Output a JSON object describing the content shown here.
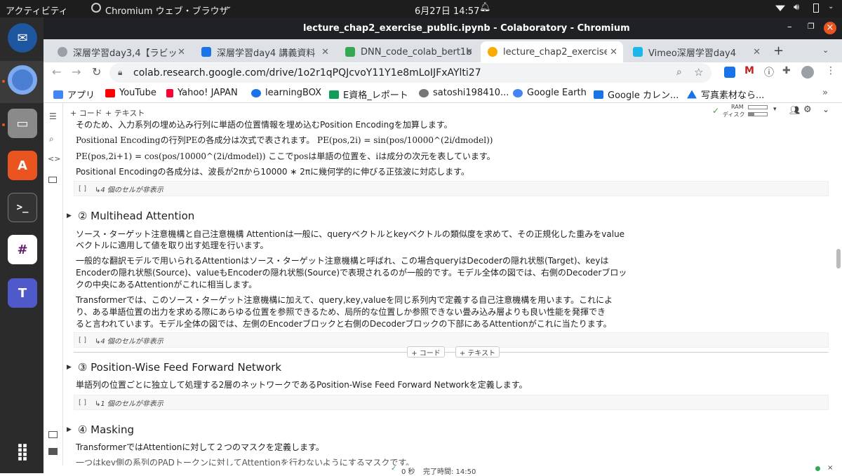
{
  "ubuntu": {
    "activities": "アクティビティ",
    "app_menu": "Chromium ウェブ・ブラウザ",
    "clock": "6月27日  14:57"
  },
  "window": {
    "title": "lecture_chap2_exercise_public.ipynb - Colaboratory - Chromium"
  },
  "tabs": [
    {
      "label": "深層学習day3,4【ラビッ",
      "color": "#9aa0a6"
    },
    {
      "label": "深層学習day4 講義資料",
      "color": "#1a73e8"
    },
    {
      "label": "DNN_code_colab_bert1b",
      "color": "#34a853"
    },
    {
      "label": "lecture_chap2_exercise_",
      "color": "#f9ab00"
    },
    {
      "label": "Vimeo深層学習day4",
      "color": "#1ab7ea"
    }
  ],
  "address": {
    "url": "colab.research.google.com/drive/1o2r1qPQJcvoY11Y1e8mLoIJFxAYlti27"
  },
  "bookmarks": [
    {
      "label": "アプリ",
      "color": "#4285f4"
    },
    {
      "label": "YouTube",
      "color": "#ff0000"
    },
    {
      "label": "Yahoo! JAPAN",
      "color": "#ff0033"
    },
    {
      "label": "learningBOX",
      "color": "#1a73e8"
    },
    {
      "label": "E資格_レポート",
      "color": "#0f9d58"
    },
    {
      "label": "satoshi198410...",
      "color": "#777777"
    },
    {
      "label": "Google Earth",
      "color": "#4285f4"
    },
    {
      "label": "Google カレン...",
      "color": "#1a73e8"
    },
    {
      "label": "写真素材なら...",
      "color": "#1a73e8"
    }
  ],
  "colab_toolbar": {
    "code_button": "+ コード",
    "text_button": "+ テキスト",
    "ram": "RAM",
    "disk": "ディスク"
  },
  "cells": {
    "pe_line1": "そのため、入力系列の埋め込み行列に単語の位置情報を埋め込むPosition Encodingを加算します。",
    "pe_line2": "Positional Encodingの行列PEの各成分は次式で表されます。 PE(pos,2i) = sin(pos/10000^(2i/dmodel))",
    "pe_line3": "PE(pos,2i+1) = cos(pos/10000^(2i/dmodel)) ここでposは単語の位置を、iは成分の次元を表しています。",
    "pe_line4": "Positional Encodingの各成分は、波長が2πから10000 ∗ 2πに幾何学的に伸びる正弦波に対応します。",
    "hidden1": "↳4 個のセルが非表示",
    "h2": "② Multihead Attention",
    "mh_p1_l1": "ソース・ターゲット注意機構と自己注意機構 Attentionは一般に、queryベクトルとkeyベクトルの類似度を求めて、その正規化した重みをvalue",
    "mh_p1_l2": "ベクトルに適用して値を取り出す処理を行います。",
    "mh_p2_l1": "一般的な翻訳モデルで用いられるAttentionはソース・ターゲット注意機構と呼ばれ、この場合queryはDecoderの隠れ状態(Target)、keyは",
    "mh_p2_l2": "Encoderの隠れ状態(Source)、valueもEncoderの隠れ状態(Source)で表現されるのが一般的です。モデル全体の図では、右側のDecoderブロッ",
    "mh_p2_l3": "クの中央にあるAttentionがこれに相当します。",
    "mh_p3_l1": "Transformerでは、このソース・ターゲット注意機構に加えて、query,key,valueを同じ系列内で定義する自己注意機構を用います。これによ",
    "mh_p3_l2": "り、ある単語位置の出力を求める際にあらゆる位置を参照できるため、局所的な位置しか参照できない畳み込み層よりも良い性能を発揮でき",
    "mh_p3_l3": "ると言われています。モデル全体の図では、左側のEncoderブロックと右側のDecoderブロックの下部にあるAttentionがこれに当たります。",
    "hidden2": "↳4 個のセルが非表示",
    "add_code": "+ コード",
    "add_text": "+ テキスト",
    "h3": "③ Position-Wise Feed Forward Network",
    "ff_p": "単語列の位置ごとに独立して処理する2層のネットワークであるPosition-Wise Feed Forward Networkを定義します。",
    "hidden3": "↳1 個のセルが非表示",
    "h4": "④ Masking",
    "mask_p": "TransformerではAttentionに対して２つのマスクを定義します。",
    "mask_cut": "一つはkey側の系列のPADトークンに対してAttentionを行わないようにするマスクです。",
    "cell_bracket": "[ ]"
  },
  "status": {
    "elapsed": "0 秒",
    "completed": "完了時間: 14:50"
  }
}
